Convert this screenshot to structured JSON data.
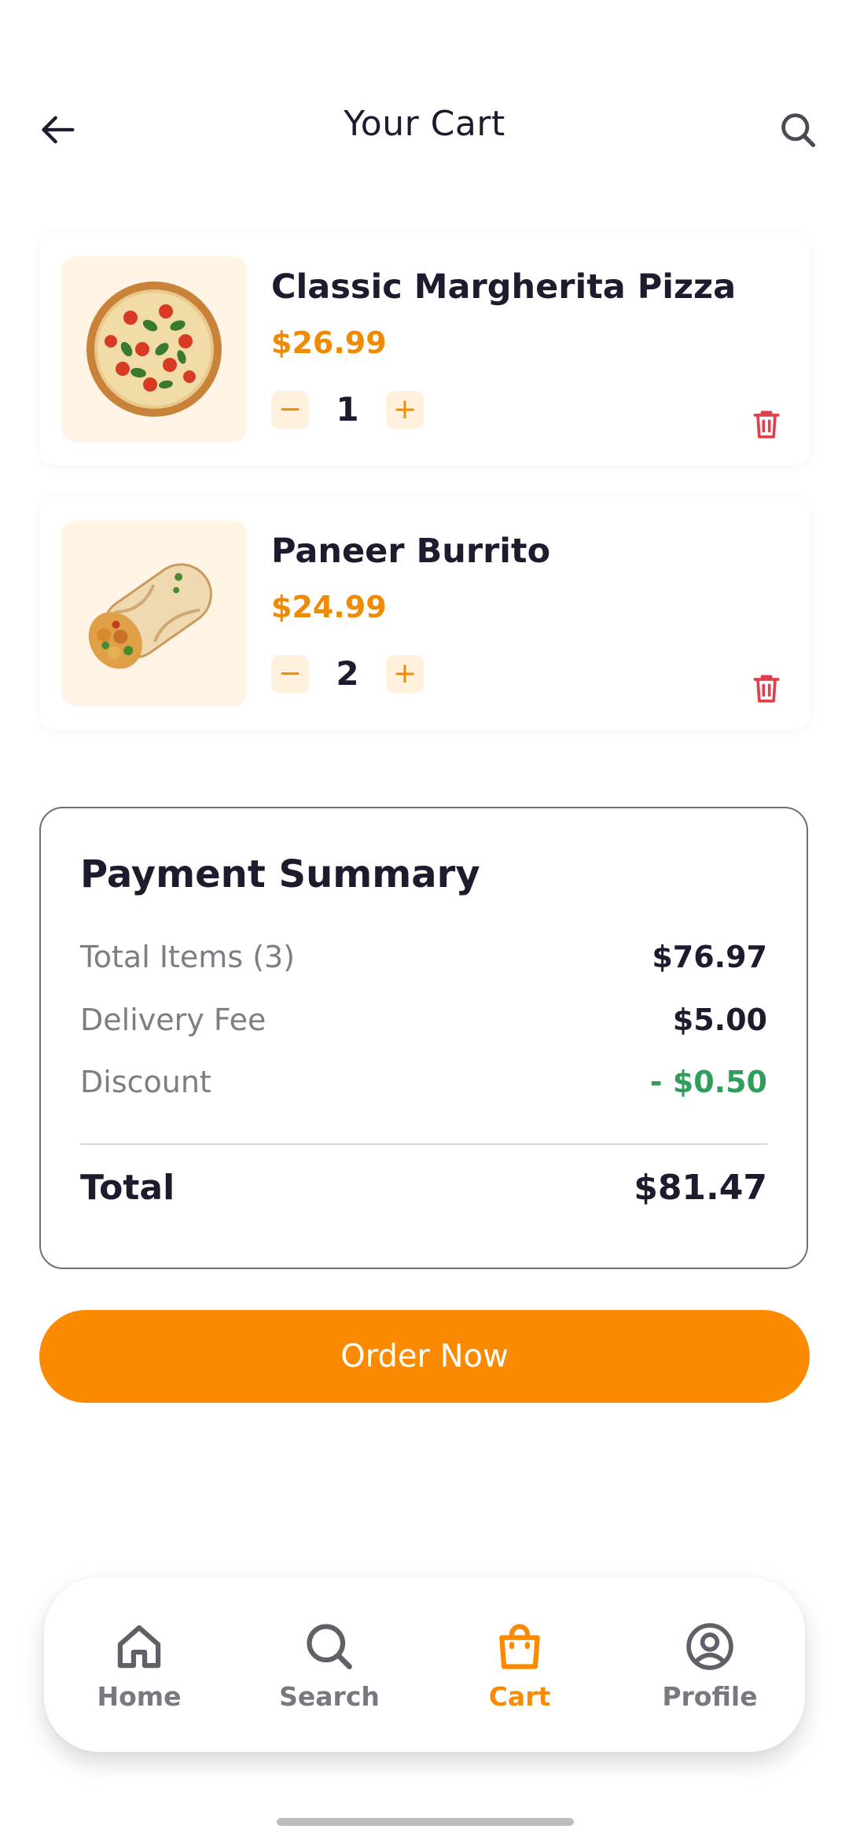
{
  "header": {
    "title": "Your Cart",
    "back_icon": "arrow-left-icon",
    "search_icon": "search-icon"
  },
  "cart": {
    "items": [
      {
        "name": "Classic Margherita Pizza",
        "price": "$26.99",
        "quantity": "1",
        "image": "pizza-image"
      },
      {
        "name": "Paneer Burrito",
        "price": "$24.99",
        "quantity": "2",
        "image": "burrito-image"
      }
    ],
    "minus_symbol": "−",
    "plus_symbol": "+"
  },
  "summary": {
    "title": "Payment Summary",
    "rows": [
      {
        "label": "Total Items (3)",
        "value": "$76.97"
      },
      {
        "label": "Delivery Fee",
        "value": "$5.00"
      },
      {
        "label": "Discount",
        "value": "- $0.50"
      }
    ],
    "total_label": "Total",
    "total_value": "$81.47"
  },
  "order_button": {
    "label": "Order Now"
  },
  "bottom_nav": {
    "items": [
      {
        "label": "Home",
        "icon": "home-icon"
      },
      {
        "label": "Search",
        "icon": "search-icon"
      },
      {
        "label": "Cart",
        "icon": "shopping-bag-icon",
        "active": true
      },
      {
        "label": "Profile",
        "icon": "profile-icon"
      }
    ]
  },
  "colors": {
    "accent": "#fb8a00",
    "price": "#f28a00",
    "discount": "#2f9e5b",
    "delete": "#e0404a",
    "text": "#1c1c2e",
    "muted": "#7d7d85",
    "thumb_bg": "#fff4e6"
  }
}
